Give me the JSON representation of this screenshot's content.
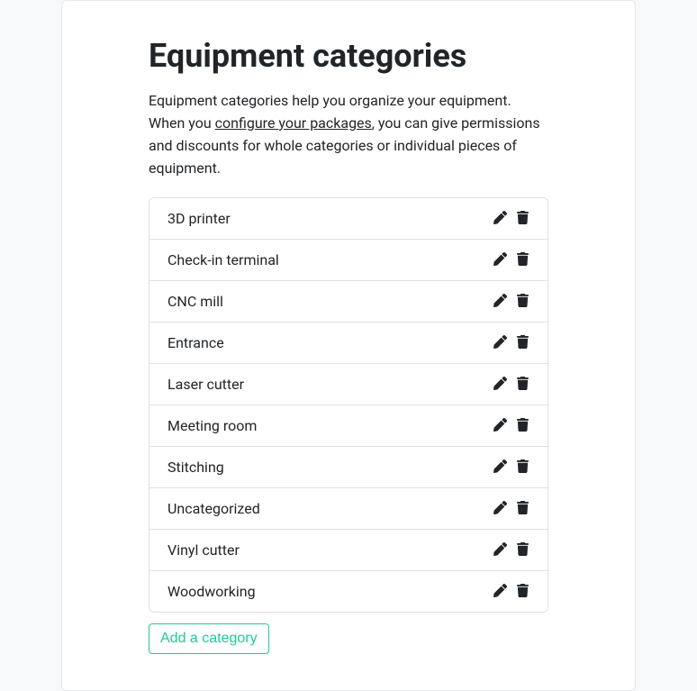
{
  "title": "Equipment categories",
  "description_pre": "Equipment categories help you organize your equipment. When you ",
  "description_link": "configure your packages",
  "description_post": ", you can give permissions and discounts for whole categories or individual pieces of equipment.",
  "categories": [
    {
      "name": "3D printer"
    },
    {
      "name": "Check-in terminal"
    },
    {
      "name": "CNC mill"
    },
    {
      "name": "Entrance"
    },
    {
      "name": "Laser cutter"
    },
    {
      "name": "Meeting room"
    },
    {
      "name": "Stitching"
    },
    {
      "name": "Uncategorized"
    },
    {
      "name": "Vinyl cutter"
    },
    {
      "name": "Woodworking"
    }
  ],
  "add_button_label": "Add a category"
}
